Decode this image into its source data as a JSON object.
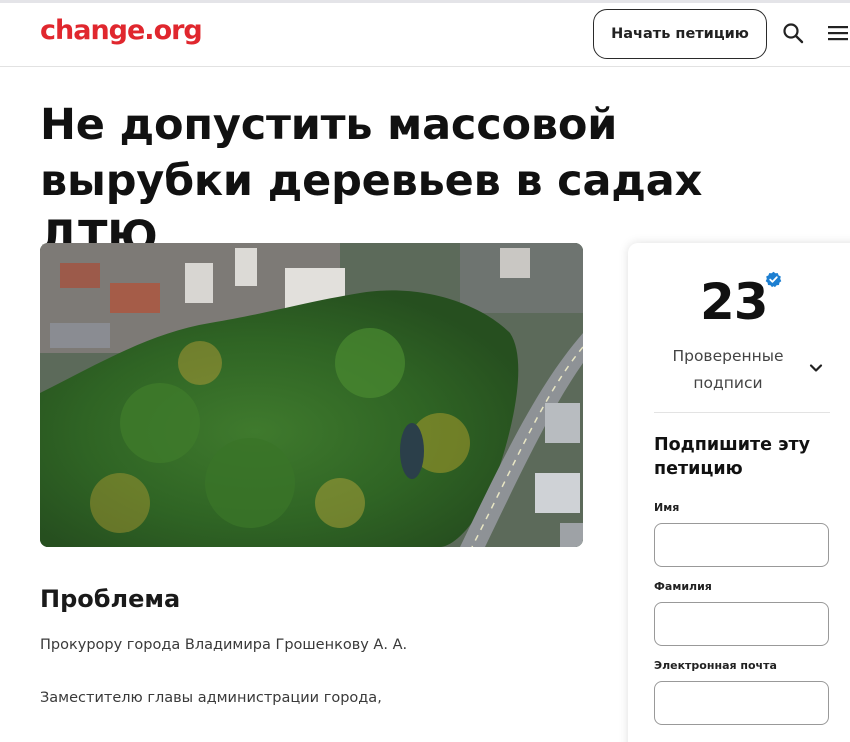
{
  "header": {
    "logo": "change.org",
    "start_petition_label": "Начать петицию",
    "icons": [
      "search-icon",
      "menu-icon"
    ]
  },
  "petition": {
    "title": "Не допустить массовой вырубки деревьев в садах ДТЮ",
    "photo_icon": "aerial-park-photo"
  },
  "problem": {
    "heading": "Проблема",
    "paragraphs": [
      "Прокурору города Владимира Грошенкову А. А.",
      "Заместителю главы администрации города,"
    ]
  },
  "signature_card": {
    "count": "23",
    "count_label": "Проверенные подписи",
    "sign_title": "Подпишите эту петицию",
    "fields": [
      {
        "label": "Имя",
        "value": "",
        "placeholder": ""
      },
      {
        "label": "Фамилия",
        "value": "",
        "placeholder": ""
      },
      {
        "label": "Электронная почта",
        "value": "",
        "placeholder": ""
      }
    ]
  },
  "colors": {
    "brand": "#e0272e",
    "verified": "#1d7fd1",
    "text": "#111111"
  }
}
